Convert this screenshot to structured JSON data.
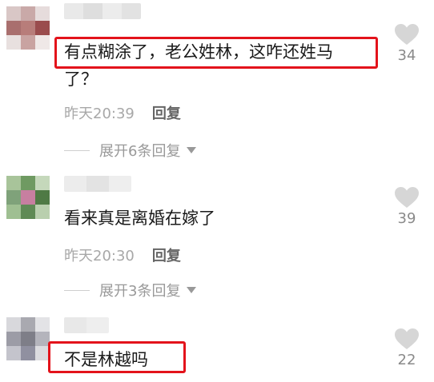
{
  "comments": [
    {
      "text_line1": "有点糊涂了，老公姓林，这咋还姓马",
      "text_line2": "了？",
      "time": "昨天20:39",
      "reply_label": "回复",
      "expand_label": "展开6条回复",
      "likes": "34"
    },
    {
      "text_line1": "看来真是离婚在嫁了",
      "time": "昨天20:30",
      "reply_label": "回复",
      "expand_label": "展开3条回复",
      "likes": "39"
    },
    {
      "text_line1": "不是林越吗",
      "likes": "22"
    }
  ],
  "colors": {
    "highlight": "#e3131b",
    "meta_text": "#a8a8a8",
    "like_icon": "#d6d6d6"
  },
  "icons": [
    "heart-icon",
    "triangle-down-icon"
  ]
}
